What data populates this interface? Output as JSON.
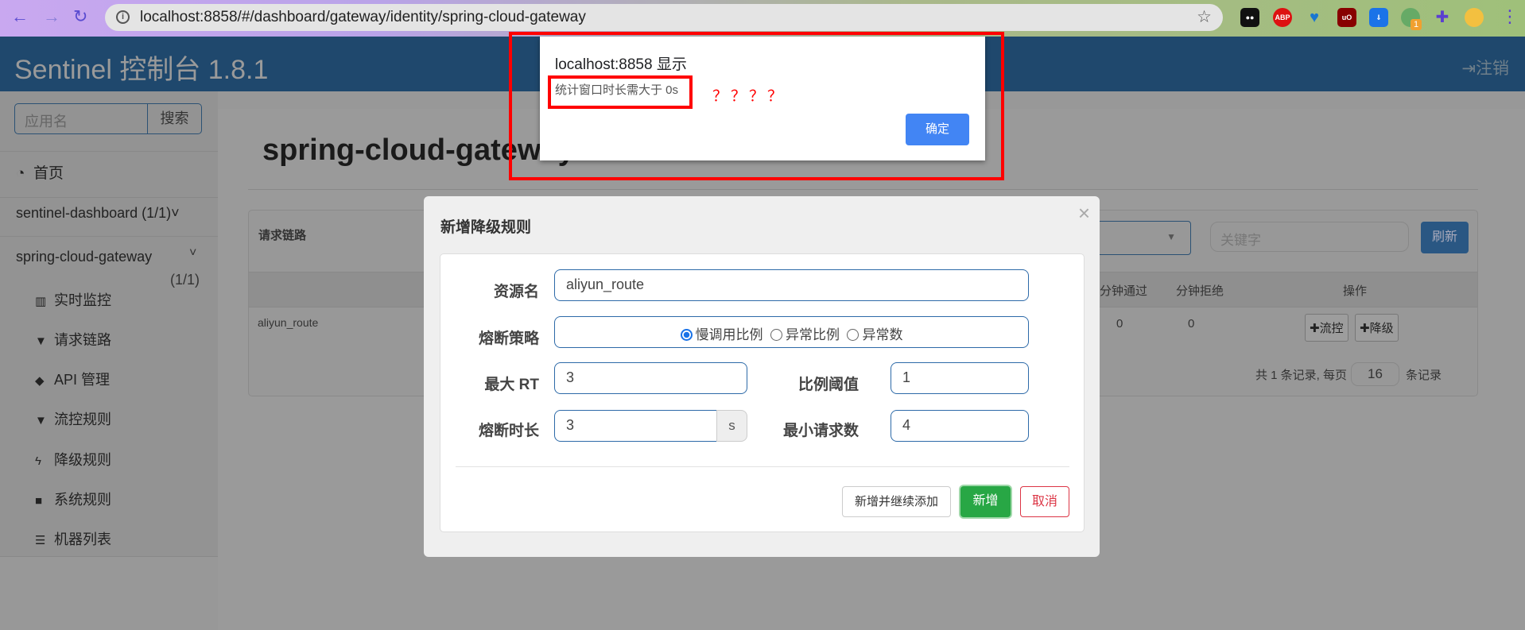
{
  "browser": {
    "url": "localhost:8858/#/dashboard/gateway/identity/spring-cloud-gateway",
    "extensions": [
      "ABP",
      "uO"
    ],
    "badge": "1"
  },
  "header": {
    "brand": "Sentinel 控制台 1.8.1",
    "logout": "注销"
  },
  "sidebar": {
    "search_placeholder": "应用名",
    "search_btn": "搜索",
    "home": "首页",
    "apps": [
      {
        "name": "sentinel-dashboard",
        "count": "(1/1)"
      },
      {
        "name": "spring-cloud-gateway",
        "count": "(1/1)"
      }
    ],
    "items": [
      {
        "label": "实时监控",
        "icon": "bar-chart-icon"
      },
      {
        "label": "请求链路",
        "icon": "filter-icon"
      },
      {
        "label": "API 管理",
        "icon": "tags-icon"
      },
      {
        "label": "流控规则",
        "icon": "filter-icon"
      },
      {
        "label": "降级规则",
        "icon": "flash-icon"
      },
      {
        "label": "系统规则",
        "icon": "lock-icon"
      },
      {
        "label": "机器列表",
        "icon": "list-icon"
      }
    ]
  },
  "main": {
    "title": "spring-cloud-gateway",
    "card_title": "请求链路",
    "keyword_placeholder": "关键字",
    "refresh": "刷新",
    "columns": [
      "分钟通过",
      "分钟拒绝",
      "操作"
    ],
    "rows": [
      {
        "resource": "aliyun_route",
        "pass": "0",
        "block": "0"
      }
    ],
    "row_actions": [
      "流控",
      "降级"
    ],
    "pagination": {
      "prefix": "共 1 条记录, 每页",
      "page_size": "16",
      "suffix": "条记录"
    }
  },
  "modal": {
    "title": "新增降级规则",
    "close": "×",
    "fields": {
      "resource_label": "资源名",
      "resource": "aliyun_route",
      "strategy_label": "熔断策略",
      "strategies": [
        "慢调用比例",
        "异常比例",
        "异常数"
      ],
      "strategy_selected": 0,
      "max_rt_label": "最大 RT",
      "max_rt": "3",
      "ratio_label": "比例阈值",
      "ratio": "1",
      "duration_label": "熔断时长",
      "duration": "3",
      "duration_unit": "s",
      "min_req_label": "最小请求数",
      "min_req": "4"
    },
    "buttons": {
      "add_continue": "新增并继续添加",
      "add": "新增",
      "cancel": "取消"
    }
  },
  "alert": {
    "title": "localhost:8858 显示",
    "message": "统计窗口时长需大于 0s",
    "ok": "确定"
  },
  "annotation": {
    "text": "？？？？",
    "color": "#ff0000"
  }
}
